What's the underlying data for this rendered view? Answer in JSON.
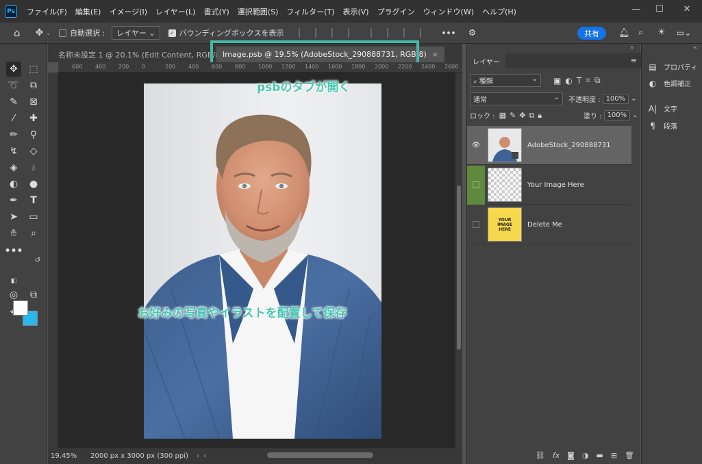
{
  "app": {
    "logo": "Ps"
  },
  "menu": [
    "ファイル(F)",
    "編集(E)",
    "イメージ(I)",
    "レイヤー(L)",
    "書式(Y)",
    "選択範囲(S)",
    "フィルター(T)",
    "表示(V)",
    "プラグイン",
    "ウィンドウ(W)",
    "ヘルプ(H)"
  ],
  "window": {
    "minimize": "—",
    "maximize": "☐",
    "close": "✕"
  },
  "options": {
    "auto_select_label": "自動選択 :",
    "auto_select_target": "レイヤー",
    "bounding_box_label": "バウンディングボックスを表示",
    "more": "•••",
    "share_label": "共有"
  },
  "tabs": [
    {
      "label": "名称未設定 1 @ 20.1% (Edit Content, RGB/8) *"
    },
    {
      "label": "Image.psb @ 19.5% (AdobeStock_290888731, RGB/8)",
      "close": "×"
    }
  ],
  "ruler": {
    "numbers": [
      "600",
      "400",
      "200",
      "0",
      "200",
      "400",
      "600",
      "800",
      "1000",
      "1200",
      "1400",
      "1600",
      "1800",
      "2000",
      "2200",
      "2400",
      "2600"
    ]
  },
  "status": {
    "zoom": "19.45%",
    "doc_info": "2000 px x 3000 px (300 ppi)"
  },
  "annotations": {
    "tab_note": "psbのタブが開く",
    "main_note": "お好みの写真やイラストを配置して保存"
  },
  "layers_panel": {
    "tab": "レイヤー",
    "filter_kind": "種類",
    "blend_mode": "通常",
    "opacity_label": "不透明度 :",
    "opacity_value": "100%",
    "lock_label": "ロック :",
    "fill_label": "塗り :",
    "fill_value": "100%",
    "layers": [
      {
        "name": "AdobeStock_290888731",
        "visible": true,
        "selected": true
      },
      {
        "name": "Your Image Here",
        "visible": false,
        "selected": false
      },
      {
        "name": "Delete Me",
        "visible": false,
        "selected": false,
        "thumb_text": "YOUR IMAGE HERE"
      }
    ],
    "bottom_icons": [
      "link-icon",
      "fx-icon",
      "mask-icon",
      "adjustment-icon",
      "folder-icon",
      "new-layer-icon",
      "trash-icon"
    ]
  },
  "right_panel": {
    "items": [
      {
        "label": "プロパティ"
      },
      {
        "label": "色調補正"
      },
      {
        "label": "文字"
      },
      {
        "label": "段落"
      }
    ]
  },
  "colors": {
    "accent": "#47b8a8",
    "share": "#1473e6",
    "background_color": "#26b8ee"
  }
}
